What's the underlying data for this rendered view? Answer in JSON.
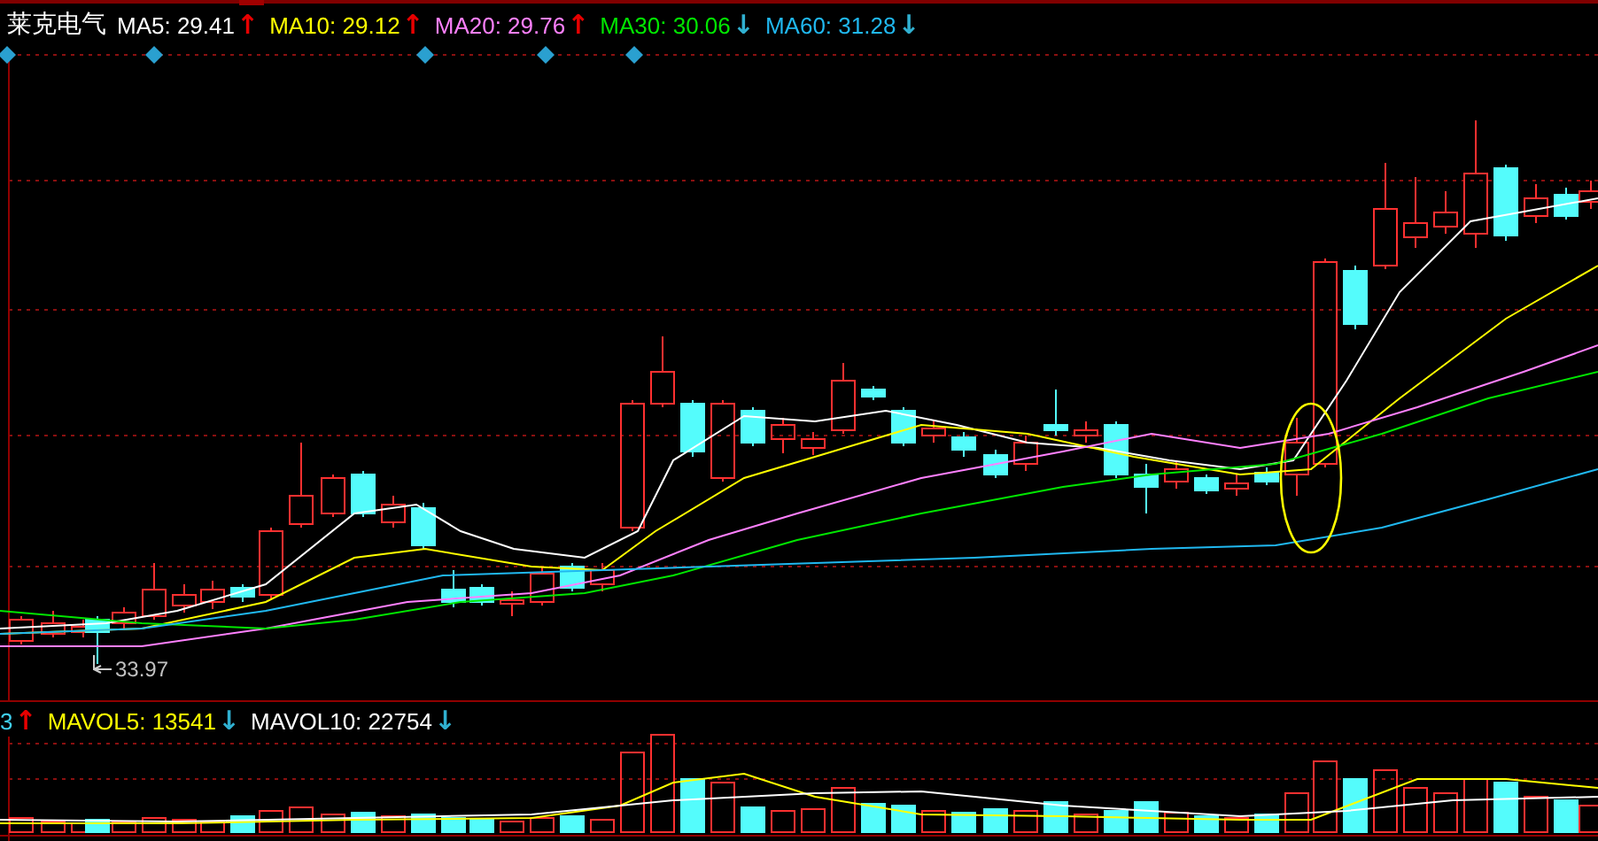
{
  "stock": {
    "name": "莱克电气"
  },
  "ma_legend": [
    {
      "text": "MA5: 29.41",
      "color": "#ffffff",
      "arrow": {
        "text": "↑",
        "color": "#e80000"
      }
    },
    {
      "text": "MA10: 29.12",
      "color": "#ffff00",
      "arrow": {
        "text": "↑",
        "color": "#e80000"
      }
    },
    {
      "text": "MA20: 29.76",
      "color": "#ff80ff",
      "arrow": {
        "text": "↑",
        "color": "#e80000"
      }
    },
    {
      "text": "MA30: 30.06",
      "color": "#00e600",
      "arrow": {
        "text": "↓",
        "color": "#30b0d0"
      }
    },
    {
      "text": "MA60: 31.28",
      "color": "#20b8f0",
      "arrow": {
        "text": "↓",
        "color": "#30b0d0"
      }
    }
  ],
  "low_price_label": "33.97",
  "volume_legend": [
    {
      "text": "3",
      "color": "#40d0f0",
      "arrow": {
        "text": "↑",
        "color": "#e80000"
      }
    },
    {
      "text": "MAVOL5: 13541",
      "color": "#ffff00",
      "arrow": {
        "text": "↓",
        "color": "#30b0d0"
      }
    },
    {
      "text": "MAVOL10: 22754",
      "color": "#ffffff",
      "arrow": {
        "text": "↓",
        "color": "#30b0d0"
      }
    }
  ]
}
